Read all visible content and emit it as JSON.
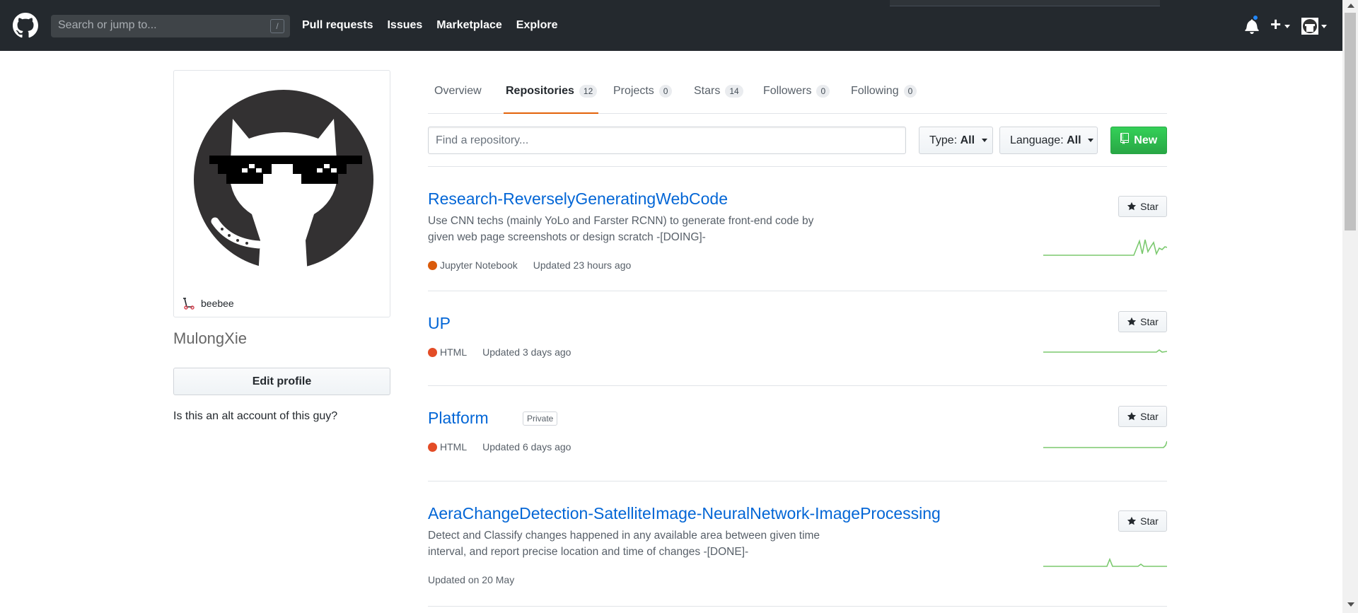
{
  "header": {
    "search_placeholder": "Search or jump to...",
    "search_shortcut": "/",
    "nav": [
      "Pull requests",
      "Issues",
      "Marketplace",
      "Explore"
    ],
    "plus": "+"
  },
  "profile": {
    "status": "beebee",
    "username": "MulongXie",
    "edit_label": "Edit profile",
    "bio": "Is this an alt account of this guy?"
  },
  "tabs": [
    {
      "label": "Overview"
    },
    {
      "label": "Repositories",
      "count": "12"
    },
    {
      "label": "Projects",
      "count": "0"
    },
    {
      "label": "Stars",
      "count": "14"
    },
    {
      "label": "Followers",
      "count": "0"
    },
    {
      "label": "Following",
      "count": "0"
    }
  ],
  "filters": {
    "find_placeholder": "Find a repository...",
    "type_label": "Type:",
    "type_value": "All",
    "language_label": "Language:",
    "language_value": "All",
    "new_label": "New"
  },
  "repos": [
    {
      "name": "Research-ReverselyGeneratingWebCode",
      "desc_lines": [
        "Use CNN techs (mainly YoLo and Farster RCNN) to generate front-end code by",
        "given web page screenshots or design scratch -[DOING]-"
      ],
      "language": "Jupyter Notebook",
      "language_color": "#DA5B0B",
      "updated": "Updated 23 hours ago",
      "star_label": "Star"
    },
    {
      "name": "UP",
      "language": "HTML",
      "language_color": "#e34c26",
      "updated": "Updated 3 days ago",
      "star_label": "Star"
    },
    {
      "name": "Platform",
      "badge": "Private",
      "language": "HTML",
      "language_color": "#e34c26",
      "updated": "Updated 6 days ago",
      "star_label": "Star"
    },
    {
      "name": "AeraChangeDetection-SatelliteImage-NeuralNetwork-ImageProcessing",
      "desc_lines": [
        "Detect and Classify changes happened in any available area between given time",
        "interval, and report precise location and time of changes -[DONE]-"
      ],
      "updated": "Updated on 20 May",
      "star_label": "Star"
    }
  ],
  "colors": {
    "header_bg": "#24292e",
    "link": "#0366d6",
    "tab_accent": "#e36209",
    "new_button": "#28a745",
    "sparkline": "#7bc96f"
  }
}
